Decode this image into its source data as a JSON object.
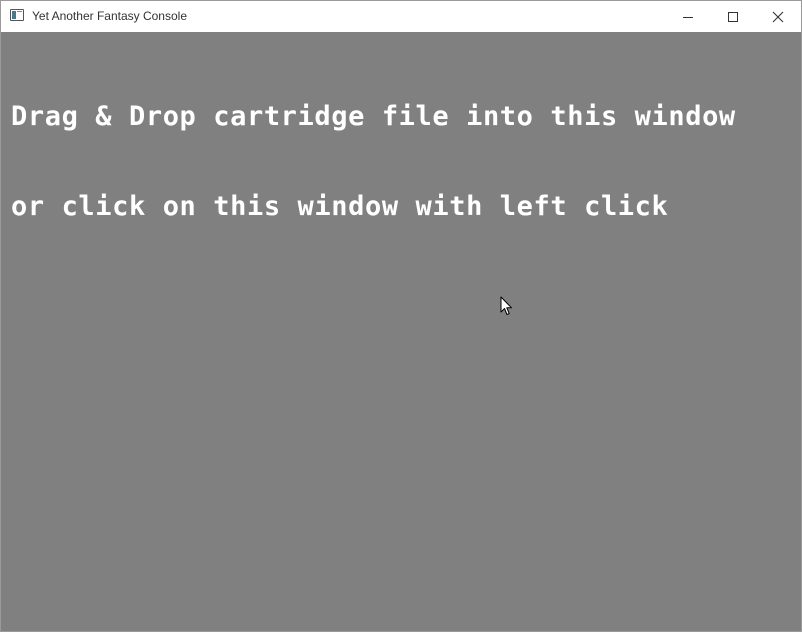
{
  "window": {
    "title": "Yet Another Fantasy Console",
    "controls": {
      "minimize_icon": "minimize-icon",
      "maximize_icon": "maximize-icon",
      "close_icon": "close-icon"
    }
  },
  "client": {
    "background_color": "#808080",
    "text_color": "#ffffff",
    "message": {
      "line1": "Drag & Drop cartridge file into this window",
      "line2": "or click on this window with left click"
    }
  },
  "cursor": {
    "icon": "arrow-cursor-icon"
  }
}
